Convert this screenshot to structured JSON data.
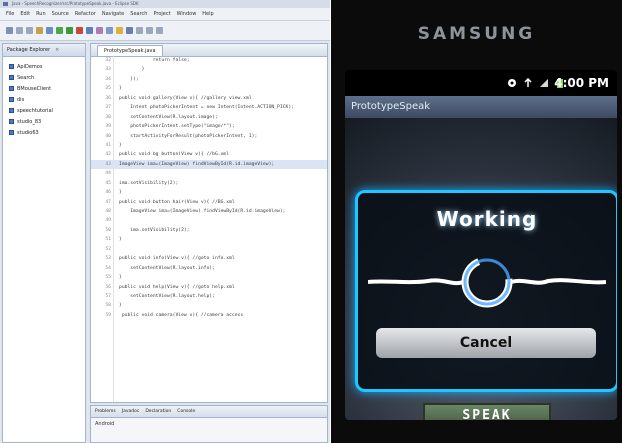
{
  "ide": {
    "title": "Java - SpeechRecognizer/src/PrototypeSpeak.java - Eclipse SDK",
    "menu": [
      "File",
      "Edit",
      "Run",
      "Source",
      "Refactor",
      "Navigate",
      "Search",
      "Project",
      "Window",
      "Help"
    ],
    "package_explorer": {
      "tab_label": "Package Explorer",
      "items": [
        "ApiDemos",
        "Search",
        "BMouseClient",
        "dis",
        "speechtutorial",
        "studio_83",
        "studio63"
      ]
    },
    "editor": {
      "tab_label": "PrototypeSpeak.java",
      "lines": [
        {
          "n": "32",
          "code": "            return false;"
        },
        {
          "n": "33",
          "code": "        }"
        },
        {
          "n": "34",
          "code": "    });"
        },
        {
          "n": "35",
          "code": "}"
        },
        {
          "n": "36",
          "code": "public void gallery(View v){ //gallery view.xml"
        },
        {
          "n": "37",
          "code": "    Intent photoPickerIntent = new Intent(Intent.ACTION_PICK);"
        },
        {
          "n": "38",
          "code": "    setContentView(R.layout.image);"
        },
        {
          "n": "39",
          "code": "    photoPickerIntent.setType(\"image/*\");"
        },
        {
          "n": "40",
          "code": "    startActivityForResult(photoPickerIntent, 1);"
        },
        {
          "n": "41",
          "code": "}"
        },
        {
          "n": "42",
          "code": "public void bg button(View v){ //bG.xml"
        },
        {
          "n": "43",
          "code": "ImageView ima=(ImageView) findViewById(R.id.imageView);"
        },
        {
          "n": "44",
          "code": ""
        },
        {
          "n": "45",
          "code": "ima.setVisibility(2);"
        },
        {
          "n": "46",
          "code": "}"
        },
        {
          "n": "47",
          "code": "public void button hair(View v){ //BG.xml"
        },
        {
          "n": "48",
          "code": "    ImageView ima=(ImageView) findViewById(R.id.imageView);"
        },
        {
          "n": "49",
          "code": ""
        },
        {
          "n": "50",
          "code": "    ima.setVisibility(2);"
        },
        {
          "n": "51",
          "code": "}"
        },
        {
          "n": "52",
          "code": ""
        },
        {
          "n": "53",
          "code": "public void info(View v){ //goto info.xml"
        },
        {
          "n": "54",
          "code": "    setContentView(R.layout.info);"
        },
        {
          "n": "55",
          "code": "}"
        },
        {
          "n": "56",
          "code": "public void help(View v){ //goto help.xml"
        },
        {
          "n": "57",
          "code": "    setContentView(R.layout.help);"
        },
        {
          "n": "58",
          "code": "}"
        },
        {
          "n": "59",
          "code": " public void camera(View v){ //camera access"
        }
      ],
      "highlight_line_index": 11
    },
    "console": {
      "tabs": [
        "Problems",
        "Javadoc",
        "Declaration",
        "Console"
      ],
      "body": "Android"
    }
  },
  "phone": {
    "brand": "SAMSUNG",
    "time": "4:00 PM",
    "app_title": "PrototypeSpeak",
    "dialog_title": "Working",
    "cancel_label": "Cancel",
    "speak_label": "SPEAK",
    "accent": "#1ec8ff"
  }
}
